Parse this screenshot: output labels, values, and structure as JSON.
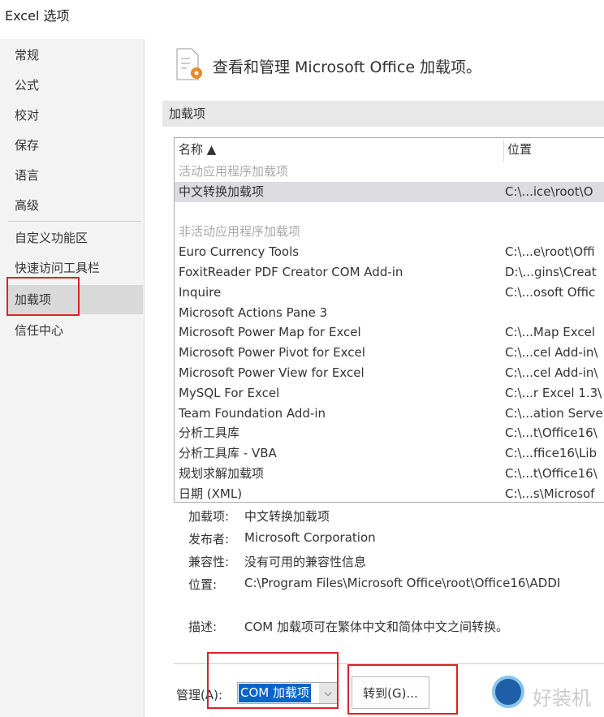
{
  "window": {
    "title": "Excel 选项"
  },
  "sidebar": {
    "items": [
      {
        "label": "常规"
      },
      {
        "label": "公式"
      },
      {
        "label": "校对"
      },
      {
        "label": "保存"
      },
      {
        "label": "语言"
      },
      {
        "label": "高级"
      },
      {
        "label": "自定义功能区"
      },
      {
        "label": "快速访问工具栏"
      },
      {
        "label": "加载项",
        "selected": true
      },
      {
        "label": "信任中心"
      }
    ]
  },
  "main": {
    "heading": "查看和管理 Microsoft Office 加载项。",
    "section": "加载项",
    "list": {
      "col_name": "名称 ▲",
      "col_location": "位置",
      "rows": [
        {
          "type": "group",
          "name": "活动应用程序加载项"
        },
        {
          "name": "中文转换加载项",
          "location": "C:\\...ice\\root\\O",
          "selected": true
        },
        {
          "type": "blank"
        },
        {
          "type": "group",
          "name": "非活动应用程序加载项"
        },
        {
          "name": "Euro Currency Tools",
          "location": "C:\\...e\\root\\Offi"
        },
        {
          "name": "FoxitReader PDF Creator COM Add-in",
          "location": "D:\\...gins\\Creat"
        },
        {
          "name": "Inquire",
          "location": "C:\\...osoft Offic"
        },
        {
          "name": "Microsoft Actions Pane 3",
          "location": ""
        },
        {
          "name": "Microsoft Power Map for Excel",
          "location": "C:\\...Map Excel"
        },
        {
          "name": "Microsoft Power Pivot for Excel",
          "location": "C:\\...cel Add-in\\"
        },
        {
          "name": "Microsoft Power View for Excel",
          "location": "C:\\...cel Add-in\\"
        },
        {
          "name": "MySQL For Excel",
          "location": "C:\\...r Excel 1.3\\"
        },
        {
          "name": "Team Foundation Add-in",
          "location": "C:\\...ation Serve"
        },
        {
          "name": "分析工具库",
          "location": "C:\\...t\\Office16\\"
        },
        {
          "name": "分析工具库 - VBA",
          "location": "C:\\...ffice16\\Lib"
        },
        {
          "name": "规划求解加载项",
          "location": "C:\\...t\\Office16\\"
        },
        {
          "name": "日期 (XML)",
          "location": "C:\\...s\\Microsof"
        }
      ]
    },
    "details": [
      {
        "label": "加载项:",
        "value": "中文转换加载项"
      },
      {
        "label": "发布者:",
        "value": "Microsoft Corporation"
      },
      {
        "label": "兼容性:",
        "value": "没有可用的兼容性信息"
      },
      {
        "label": "位置:",
        "value": "C:\\Program Files\\Microsoft Office\\root\\Office16\\ADDI"
      },
      {
        "label": "描述:",
        "value": "COM 加载项可在繁体中文和简体中文之间转换。"
      }
    ],
    "manage_label": "管理(A):",
    "manage_value": "COM 加载项",
    "go_button": "转到(G)..."
  },
  "watermark": "好装机"
}
